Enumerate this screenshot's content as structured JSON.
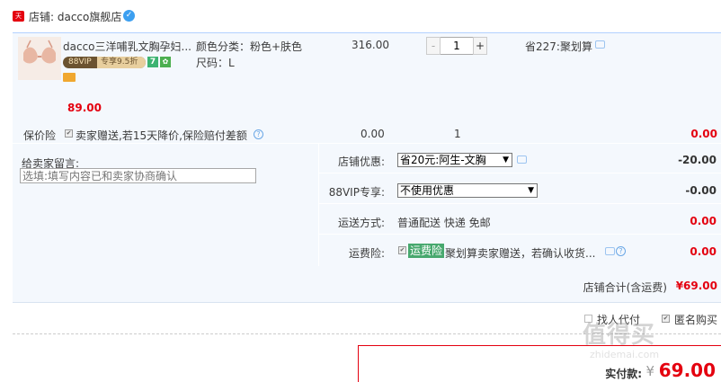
{
  "shop": {
    "logo_text": "天猫",
    "name": "店铺: dacco旗舰店",
    "verify_icon": "verified-icon"
  },
  "item": {
    "title": "dacco三洋哺乳文胸孕妇...",
    "vip_badge": "88VIP",
    "vip_discount": "专享9.5折",
    "tag_7": "7",
    "sku_color": "颜色分类：粉色+肤色",
    "sku_size": "尺码：L",
    "unit_price": "316.00",
    "quantity": "1",
    "qty_minus": "-",
    "qty_plus": "+",
    "saving": "省227:聚划算",
    "discounted_price": "89.00"
  },
  "insurance": {
    "label": "保价险",
    "desc": "卖家赠送,若15天降价,保险赔付差额",
    "price": "0.00",
    "qty": "1",
    "total": "0.00"
  },
  "message": {
    "label": "给卖家留言:",
    "placeholder": "选填:填写内容已和卖家协商确认"
  },
  "options": {
    "shop_coupon_label": "店铺优惠:",
    "shop_coupon_value": "省20元:阿生-文胸",
    "shop_coupon_amount": "-20.00",
    "vip_label": "88VIP专享:",
    "vip_value": "不使用优惠",
    "vip_amount": "-0.00",
    "shipping_label": "运送方式:",
    "shipping_value": "普通配送 快递 免邮",
    "shipping_amount": "0.00",
    "freight_ins_label": "运费险:",
    "freight_ins_tag": "运费险",
    "freight_ins_desc": "聚划算卖家赠送，若确认收货...",
    "freight_ins_amount": "0.00"
  },
  "total": {
    "label": "店铺合计(含运费)",
    "value": "¥69.00"
  },
  "extras": {
    "proxy_label": "找人代付",
    "anon_label": "匿名购买"
  },
  "payment": {
    "label": "实付款:",
    "currency": "¥",
    "value": "69.00"
  },
  "watermark": {
    "main": "值得买",
    "sub": "zhidemai.com"
  },
  "colors": {
    "accent_red": "#e4000f",
    "panel_bg": "#f4f8fd",
    "freight_tag_bg": "#47a86e"
  }
}
